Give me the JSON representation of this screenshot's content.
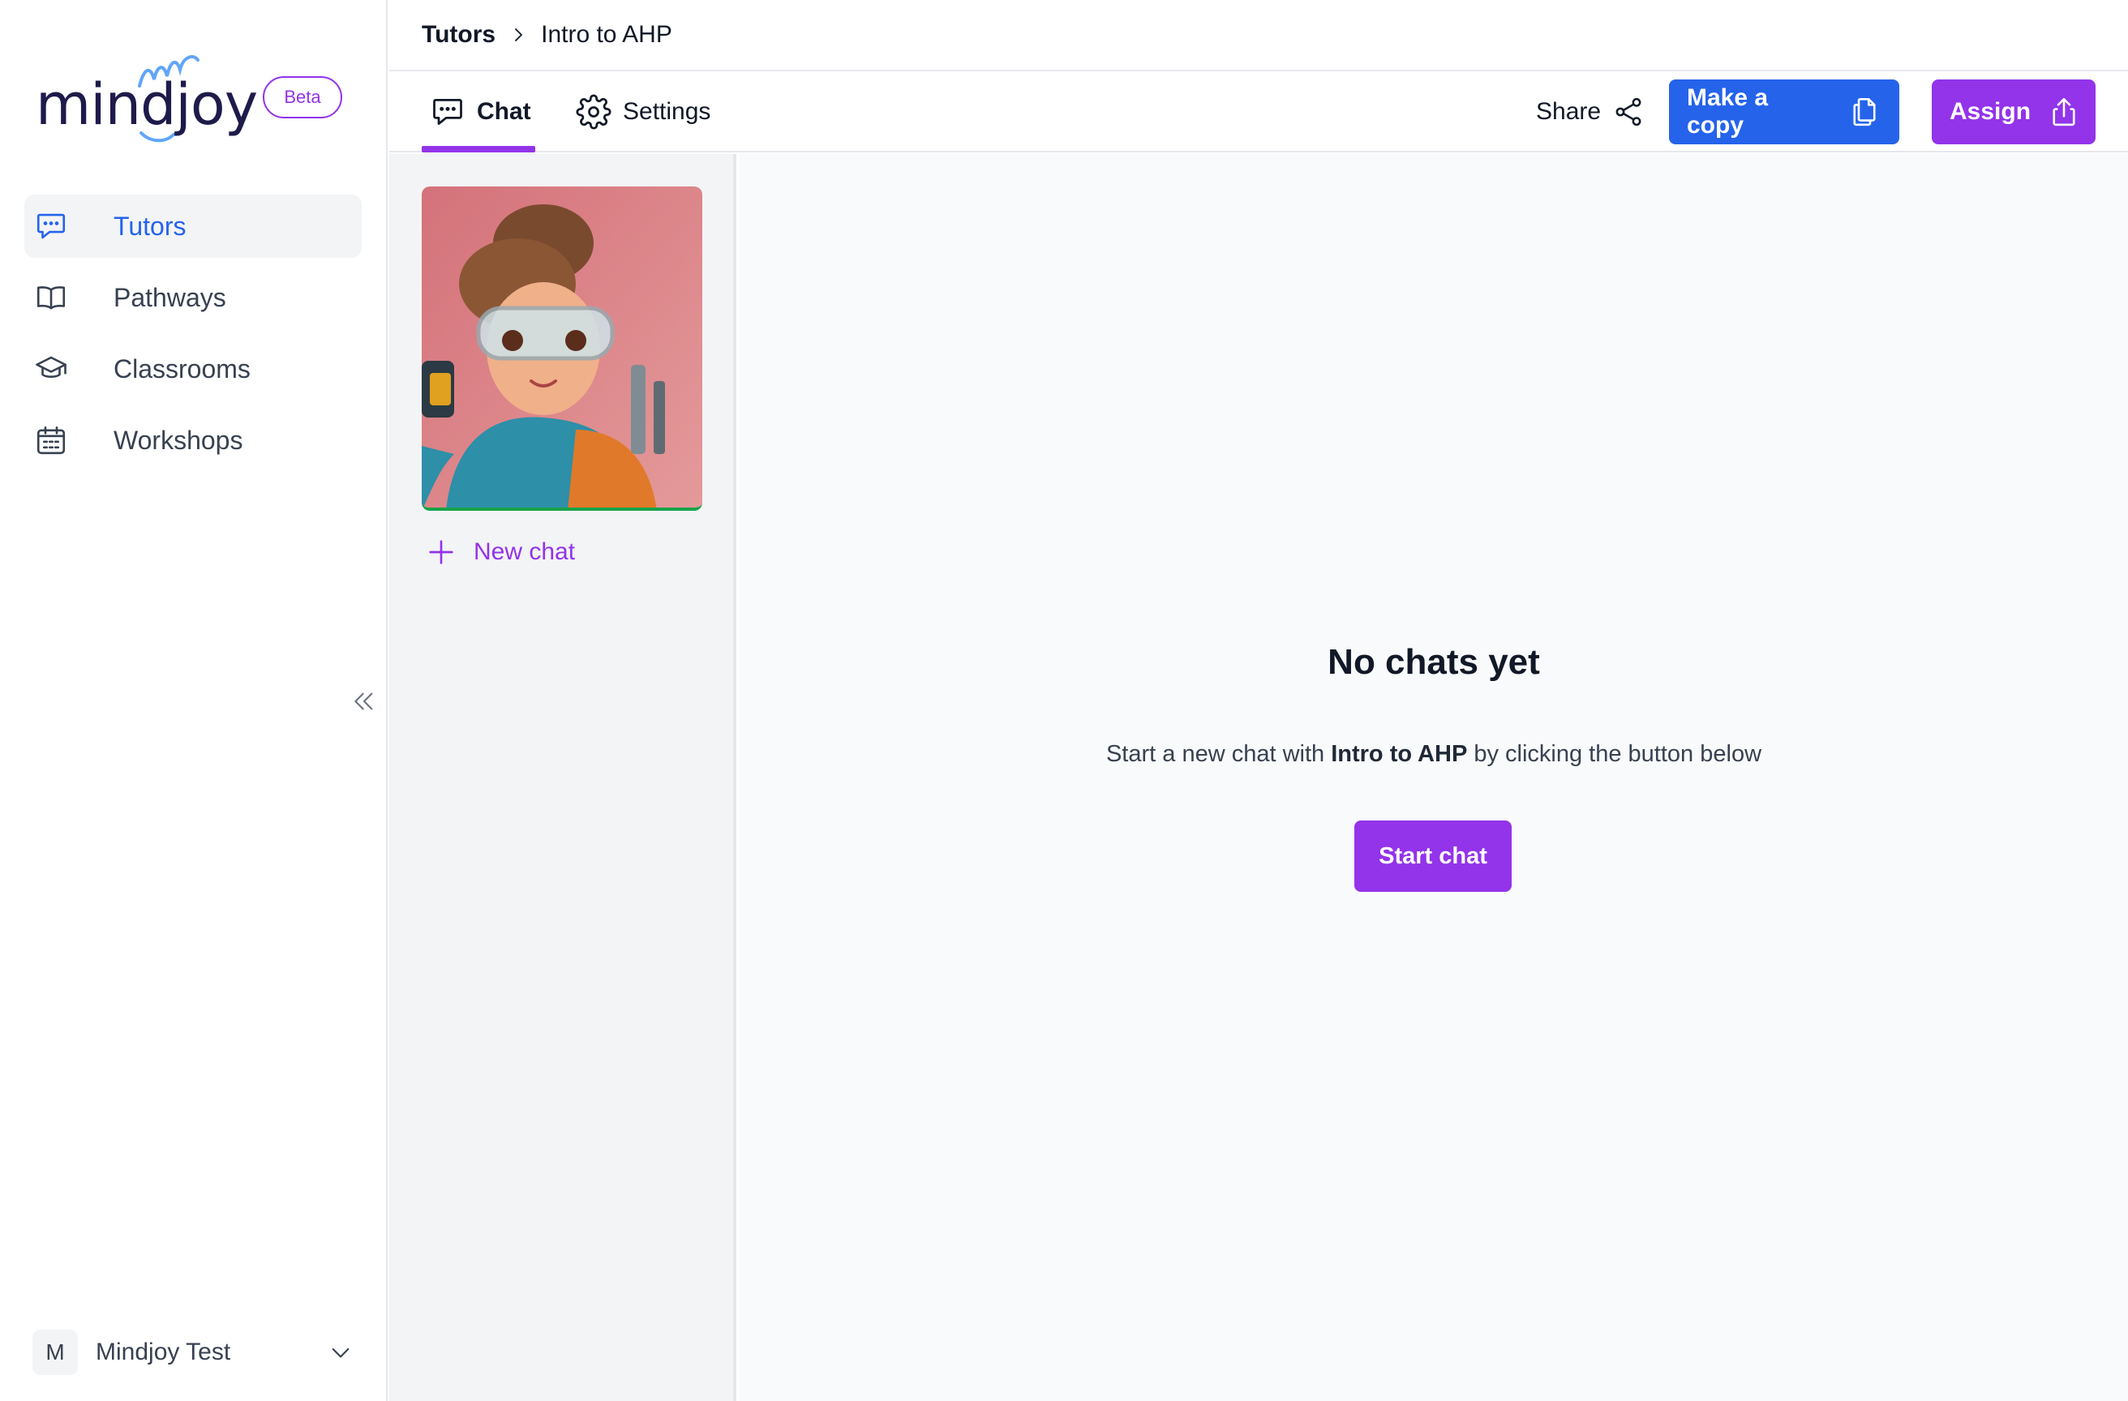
{
  "brand": {
    "name": "mindjoy",
    "badge": "Beta"
  },
  "sidebar": {
    "items": [
      {
        "label": "Tutors",
        "icon": "chat-bubble-icon",
        "active": true
      },
      {
        "label": "Pathways",
        "icon": "book-icon"
      },
      {
        "label": "Classrooms",
        "icon": "graduation-cap-icon"
      },
      {
        "label": "Workshops",
        "icon": "calendar-icon"
      }
    ],
    "user": {
      "initial": "M",
      "name": "Mindjoy Test"
    }
  },
  "breadcrumb": {
    "root": "Tutors",
    "current": "Intro to AHP"
  },
  "tabs": [
    {
      "label": "Chat",
      "active": true
    },
    {
      "label": "Settings"
    }
  ],
  "actions": {
    "share": "Share",
    "copy": "Make a copy",
    "assign": "Assign"
  },
  "chat_list": {
    "new_chat": "New chat"
  },
  "empty": {
    "title": "No chats yet",
    "sub_prefix": "Start a new chat with ",
    "tutor_name": "Intro to AHP",
    "sub_suffix": " by clicking the button below",
    "button": "Start chat"
  },
  "colors": {
    "accent": "#9333ea",
    "primary": "#2563eb"
  }
}
